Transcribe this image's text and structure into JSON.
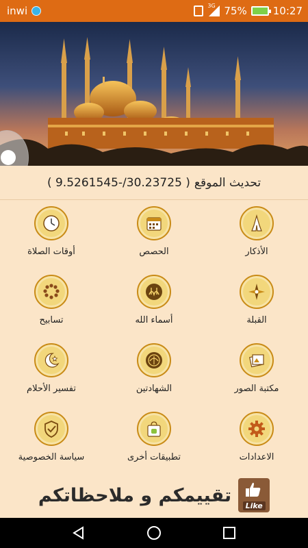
{
  "status_bar": {
    "carrier": "inwi",
    "network": "3G",
    "battery": "75%",
    "time": "10:27"
  },
  "location": {
    "label": "تحديث الموقع",
    "coords": "( 9.5261545-/30.23725 )"
  },
  "tiles": [
    {
      "label": "الأذكار",
      "icon": "praying-hands-icon"
    },
    {
      "label": "الحصص",
      "icon": "calendar-icon"
    },
    {
      "label": "أوقات الصلاة",
      "icon": "clock-icon"
    },
    {
      "label": "القبلة",
      "icon": "compass-icon"
    },
    {
      "label": "أسماء الله",
      "icon": "allah-calligraphy-icon"
    },
    {
      "label": "تسابيح",
      "icon": "prayer-beads-icon"
    },
    {
      "label": "مكتبة الصور",
      "icon": "photo-library-icon"
    },
    {
      "label": "الشهادتين",
      "icon": "shahada-calligraphy-icon"
    },
    {
      "label": "تفسير الأحلام",
      "icon": "moon-stars-icon"
    },
    {
      "label": "الاعدادات",
      "icon": "gear-icon"
    },
    {
      "label": "تطبيقات أخرى",
      "icon": "shopping-bag-icon"
    },
    {
      "label": "سياسة الخصوصية",
      "icon": "shield-check-icon"
    }
  ],
  "rating": {
    "text": "تقييمكم و ملاحظاتكم",
    "like_label": "Like"
  },
  "colors": {
    "status_bar": "#de6b14",
    "background": "#fbe5c8",
    "icon_ring": "#c98b17",
    "icon_fill": "#f2d77c"
  }
}
